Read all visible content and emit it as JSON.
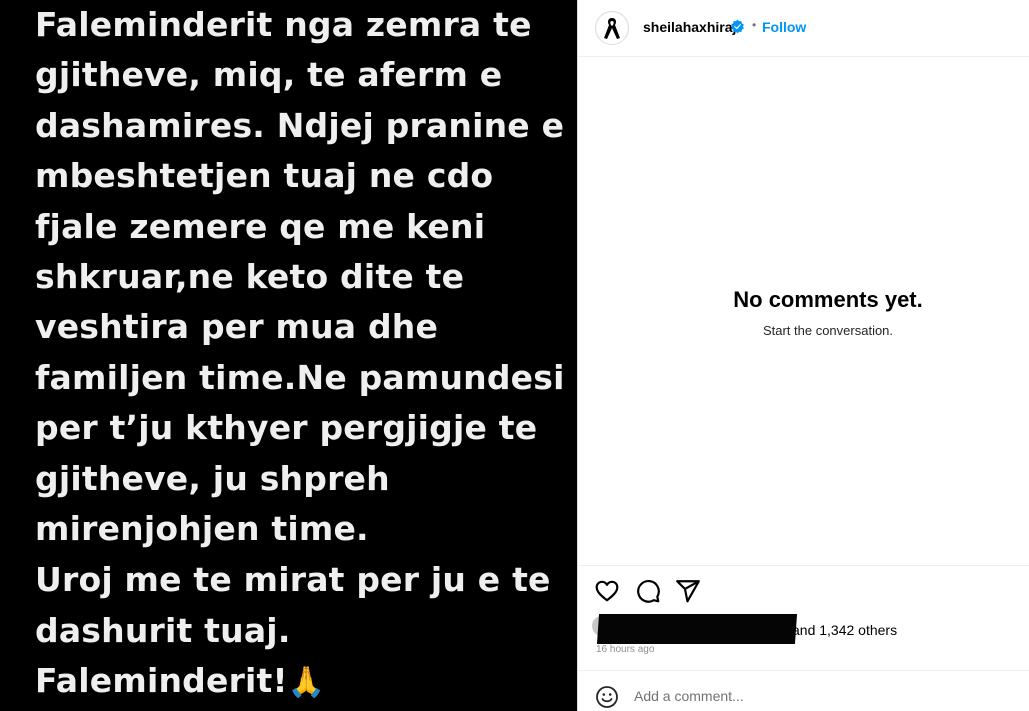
{
  "post": {
    "lines": [
      "Faleminderit nga zemra te",
      "gjitheve, miq, te aferm e",
      "dashamires. Ndjej pranine e",
      "mbeshtetjen tuaj ne cdo",
      "fjale zemere qe me keni",
      "shkruar,ne keto dite te",
      "veshtira per mua dhe",
      "familjen time.Ne pamundesi",
      "per t’ju kthyer pergjigje te",
      "gjitheve, ju shpreh",
      "mirenjohjen time.",
      "Uroj me te mirat per ju e te",
      "dashurit tuaj.",
      "Faleminderit!"
    ],
    "final_emoji": "🙏"
  },
  "header": {
    "username": "sheilahaxhiraj",
    "separator": "•",
    "follow_label": "Follow",
    "avatar_icon": "black-ribbon-icon",
    "verified_icon": "verified-badge-icon"
  },
  "comments": {
    "empty_title": "No comments yet.",
    "empty_subtitle": "Start the conversation."
  },
  "actions": {
    "icons": [
      "heart-icon",
      "comment-icon",
      "share-icon"
    ]
  },
  "likes": {
    "others_text": "and 1,342 others",
    "time_text": "16 hours ago"
  },
  "comment_box": {
    "placeholder": "Add a comment...",
    "emoji_icon": "emoji-icon"
  },
  "colors": {
    "media_background": "#000000",
    "post_text": "#efefef",
    "follow_blue": "#0095f6",
    "verified_blue": "#0095f6"
  }
}
